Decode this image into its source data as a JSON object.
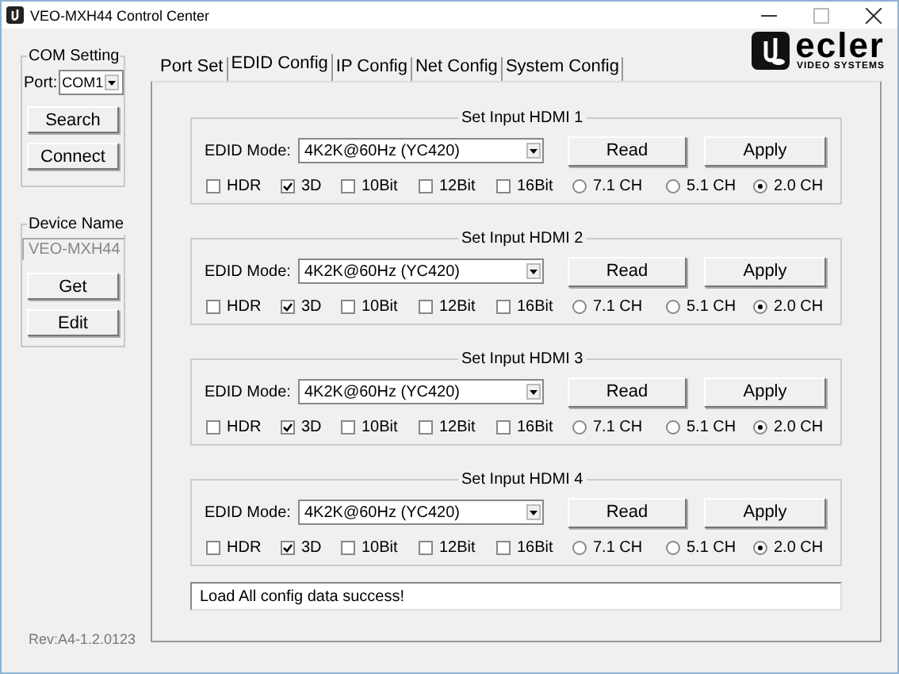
{
  "window": {
    "title": "VEO-MXH44 Control Center"
  },
  "com_setting": {
    "title": "COM Setting",
    "port_label": "Port:",
    "port": "COM1",
    "buttons": [
      "Search",
      "Connect"
    ]
  },
  "device_name": {
    "title": "Device Name",
    "value": "VEO-MXH44",
    "buttons": [
      "Get",
      "Edit"
    ]
  },
  "revision": "Rev:A4-1.2.0123",
  "logo": {
    "name": "ecler",
    "tagline": "VIDEO SYSTEMS"
  },
  "tabs": [
    {
      "label": "Port Set",
      "selected": false
    },
    {
      "label": "EDID Config",
      "selected": true
    },
    {
      "label": "IP Config",
      "selected": false
    },
    {
      "label": "Net Config",
      "selected": false
    },
    {
      "label": "System Config",
      "selected": false
    }
  ],
  "inputs": [
    {
      "title": "Set Input HDMI  1",
      "mode_label": "EDID Mode:",
      "mode": "4K2K@60Hz (YC420)",
      "read": "Read",
      "apply": "Apply",
      "options": [
        {
          "kind": "checkbox",
          "label": "HDR",
          "checked": false
        },
        {
          "kind": "checkbox",
          "label": "3D",
          "checked": true
        },
        {
          "kind": "checkbox",
          "label": "10Bit",
          "checked": false
        },
        {
          "kind": "checkbox",
          "label": "12Bit",
          "checked": false
        },
        {
          "kind": "checkbox",
          "label": "16Bit",
          "checked": false
        },
        {
          "kind": "radio",
          "label": "7.1 CH",
          "selected": false
        },
        {
          "kind": "radio",
          "label": "5.1 CH",
          "selected": false
        },
        {
          "kind": "radio",
          "label": "2.0 CH",
          "selected": true
        }
      ]
    },
    {
      "title": "Set Input HDMI  2",
      "mode_label": "EDID Mode:",
      "mode": "4K2K@60Hz (YC420)",
      "read": "Read",
      "apply": "Apply",
      "options": [
        {
          "kind": "checkbox",
          "label": "HDR",
          "checked": false
        },
        {
          "kind": "checkbox",
          "label": "3D",
          "checked": true
        },
        {
          "kind": "checkbox",
          "label": "10Bit",
          "checked": false
        },
        {
          "kind": "checkbox",
          "label": "12Bit",
          "checked": false
        },
        {
          "kind": "checkbox",
          "label": "16Bit",
          "checked": false
        },
        {
          "kind": "radio",
          "label": "7.1 CH",
          "selected": false
        },
        {
          "kind": "radio",
          "label": "5.1 CH",
          "selected": false
        },
        {
          "kind": "radio",
          "label": "2.0 CH",
          "selected": true
        }
      ]
    },
    {
      "title": "Set Input HDMI  3",
      "mode_label": "EDID Mode:",
      "mode": "4K2K@60Hz (YC420)",
      "read": "Read",
      "apply": "Apply",
      "options": [
        {
          "kind": "checkbox",
          "label": "HDR",
          "checked": false
        },
        {
          "kind": "checkbox",
          "label": "3D",
          "checked": true
        },
        {
          "kind": "checkbox",
          "label": "10Bit",
          "checked": false
        },
        {
          "kind": "checkbox",
          "label": "12Bit",
          "checked": false
        },
        {
          "kind": "checkbox",
          "label": "16Bit",
          "checked": false
        },
        {
          "kind": "radio",
          "label": "7.1 CH",
          "selected": false
        },
        {
          "kind": "radio",
          "label": "5.1 CH",
          "selected": false
        },
        {
          "kind": "radio",
          "label": "2.0 CH",
          "selected": true
        }
      ]
    },
    {
      "title": "Set Input HDMI  4",
      "mode_label": "EDID Mode:",
      "mode": "4K2K@60Hz (YC420)",
      "read": "Read",
      "apply": "Apply",
      "options": [
        {
          "kind": "checkbox",
          "label": "HDR",
          "checked": false
        },
        {
          "kind": "checkbox",
          "label": "3D",
          "checked": true
        },
        {
          "kind": "checkbox",
          "label": "10Bit",
          "checked": false
        },
        {
          "kind": "checkbox",
          "label": "12Bit",
          "checked": false
        },
        {
          "kind": "checkbox",
          "label": "16Bit",
          "checked": false
        },
        {
          "kind": "radio",
          "label": "7.1 CH",
          "selected": false
        },
        {
          "kind": "radio",
          "label": "5.1 CH",
          "selected": false
        },
        {
          "kind": "radio",
          "label": "2.0 CH",
          "selected": true
        }
      ]
    }
  ],
  "message": "Load All config data success!"
}
